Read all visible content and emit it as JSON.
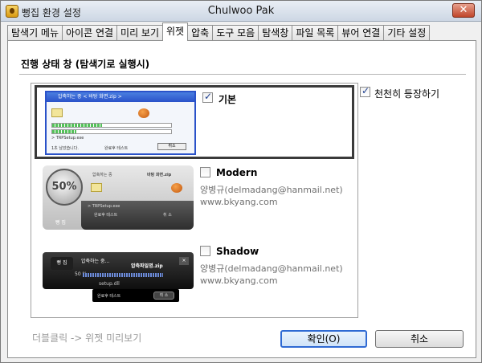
{
  "window": {
    "title": "뻥집 환경 설정",
    "center_title": "Chulwoo Pak",
    "close_glyph": "✕"
  },
  "tabs": [
    {
      "label": "탐색기 메뉴",
      "active": false
    },
    {
      "label": "아이콘 연결",
      "active": false
    },
    {
      "label": "미리 보기",
      "active": false
    },
    {
      "label": "위젯",
      "active": true
    },
    {
      "label": "압축",
      "active": false
    },
    {
      "label": "도구 모음",
      "active": false
    },
    {
      "label": "탐색창",
      "active": false
    },
    {
      "label": "파일 목록",
      "active": false
    },
    {
      "label": "뷰어 연결",
      "active": false
    },
    {
      "label": "기타 설정",
      "active": false
    }
  ],
  "panel": {
    "heading": "진행 상태 창 (탐색기로 실행시)",
    "slide_in_label": "천천히 등장하기",
    "slide_in_checked": true,
    "hint": "더블클릭 -> 위젯 미리보기"
  },
  "skins": [
    {
      "name": "기본",
      "checked": true,
      "selected": true,
      "author": "",
      "site": "",
      "preview": {
        "title": "압축하는 중 < 바탕 화면.zip >",
        "file": "> TRPSetup.exe",
        "remaining": "1초 남았습니다.",
        "option": "완료후 테스트",
        "cancel": "취소"
      }
    },
    {
      "name": "Modern",
      "checked": false,
      "selected": false,
      "author": "양병규(delmadang@hanmail.net)",
      "site": "www.bkyang.com",
      "preview": {
        "percent": "50%",
        "title": "압축하는 중",
        "archive": "바탕 화면.zip",
        "file": "> TRPSetup.exe",
        "option": "완료후 테스트",
        "cancel": "취 소",
        "brand": "뻥 집"
      }
    },
    {
      "name": "Shadow",
      "checked": false,
      "selected": false,
      "author": "양병규(delmadang@hanmail.net)",
      "site": "www.bkyang.com",
      "preview": {
        "brand": "뻥 집",
        "title": "압축하는 중...",
        "archive": "압축파일명.zip",
        "percent": "50 %",
        "file": "setup.dll",
        "option": "완료후 테스트",
        "cancel": "취 소"
      }
    }
  ],
  "buttons": {
    "ok": "확인(O)",
    "cancel": "취소"
  },
  "colors": {
    "accent": "#2a52c9",
    "progress": "#54c15a",
    "close": "#c0452a"
  },
  "icons": {
    "app": "bbang-app-icon",
    "folder": "folder-icon",
    "ball": "orange-ball-icon",
    "check": "checkmark-icon"
  }
}
